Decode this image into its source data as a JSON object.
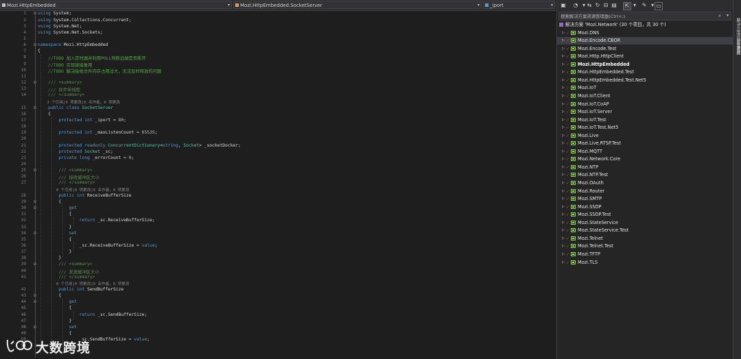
{
  "nav": {
    "project": "Mozi.HttpEmbedded",
    "class": "Mozi.HttpEmbedded.SocketServer",
    "member": "_iport"
  },
  "editor": {
    "lines": [
      {
        "n": 1,
        "seg": [
          [
            "kw",
            "using"
          ],
          [
            "id",
            " System;"
          ]
        ]
      },
      {
        "n": 2,
        "seg": [
          [
            "kw",
            "using"
          ],
          [
            "id",
            " System.Collections.Concurrent;"
          ]
        ]
      },
      {
        "n": 3,
        "seg": [
          [
            "kw",
            "using"
          ],
          [
            "id",
            " System.Net;"
          ]
        ]
      },
      {
        "n": 4,
        "seg": [
          [
            "kw",
            "using"
          ],
          [
            "id",
            " System.Net.Sockets;"
          ]
        ]
      },
      {
        "n": 5,
        "seg": []
      },
      {
        "n": 6,
        "seg": [
          [
            "kw",
            "namespace"
          ],
          [
            "id",
            " Mozi.HttpEmbedded"
          ]
        ]
      },
      {
        "n": 7,
        "seg": [
          [
            "id",
            "{"
          ]
        ]
      },
      {
        "n": 8,
        "seg": [
          [
            "cm",
            "    //TODO 加入定时器并利用POLL判断远端是否断开"
          ]
        ]
      },
      {
        "n": 9,
        "seg": [
          [
            "cm",
            "    //TODO 实现链接复用"
          ]
        ]
      },
      {
        "n": 10,
        "seg": [
          [
            "cm",
            "    //TODO 解决接收文件内存占用过大，无法及时释放的问题"
          ]
        ]
      },
      {
        "n": 11,
        "seg": []
      },
      {
        "n": 12,
        "seg": [
          [
            "xd",
            "    /// <summary>"
          ]
        ]
      },
      {
        "n": 13,
        "seg": [
          [
            "xd",
            "    /// 异步单线程"
          ]
        ]
      },
      {
        "n": 14,
        "seg": [
          [
            "xd",
            "    /// </summary>"
          ]
        ],
        "lens": "    3 个引用|0 项更改|0 名作者，0 项更改"
      },
      {
        "n": 15,
        "seg": [
          [
            "kw",
            "    public class "
          ],
          [
            "ty",
            "SocketServer"
          ]
        ]
      },
      {
        "n": 16,
        "seg": [
          [
            "id",
            "    {"
          ]
        ]
      },
      {
        "n": 17,
        "seg": [
          [
            "kw",
            "        protected int "
          ],
          [
            "id",
            "_iport = "
          ],
          [
            "num",
            "80"
          ],
          [
            "id",
            ";"
          ]
        ]
      },
      {
        "n": 18,
        "seg": []
      },
      {
        "n": 19,
        "seg": [
          [
            "kw",
            "        protected int "
          ],
          [
            "id",
            "_maxListenCount = "
          ],
          [
            "num",
            "65535"
          ],
          [
            "id",
            ";"
          ]
        ]
      },
      {
        "n": 20,
        "seg": []
      },
      {
        "n": 21,
        "seg": [
          [
            "kw",
            "        protected readonly "
          ],
          [
            "ty",
            "ConcurrentDictionary"
          ],
          [
            "id",
            "<"
          ],
          [
            "kw",
            "string"
          ],
          [
            "id",
            ", "
          ],
          [
            "ty",
            "Socket"
          ],
          [
            "id",
            "> _socketDocker;"
          ]
        ]
      },
      {
        "n": 22,
        "seg": [
          [
            "kw",
            "        protected "
          ],
          [
            "ty",
            "Socket"
          ],
          [
            "id",
            " _sc;"
          ]
        ]
      },
      {
        "n": 23,
        "seg": [
          [
            "kw",
            "        private long "
          ],
          [
            "id",
            "_errorCount = "
          ],
          [
            "num",
            "0"
          ],
          [
            "id",
            ";"
          ]
        ]
      },
      {
        "n": 24,
        "seg": []
      },
      {
        "n": 25,
        "seg": [
          [
            "xd",
            "        /// <summary>"
          ]
        ]
      },
      {
        "n": 26,
        "seg": [
          [
            "xd",
            "        /// 接收缓冲区大小"
          ]
        ]
      },
      {
        "n": 27,
        "seg": [
          [
            "xd",
            "        /// </summary>"
          ]
        ],
        "lens": "        0 个引用|0 项更改|0 名作者，0 项更改"
      },
      {
        "n": 28,
        "seg": [
          [
            "kw",
            "        public int "
          ],
          [
            "id",
            "ReceiveBufferSize"
          ]
        ]
      },
      {
        "n": 29,
        "seg": [
          [
            "id",
            "        {"
          ]
        ]
      },
      {
        "n": 30,
        "seg": [
          [
            "kw",
            "            get"
          ]
        ]
      },
      {
        "n": 31,
        "seg": [
          [
            "id",
            "            {"
          ]
        ]
      },
      {
        "n": 32,
        "seg": [
          [
            "kw",
            "                return "
          ],
          [
            "id",
            "_sc.ReceiveBufferSize;"
          ]
        ]
      },
      {
        "n": 33,
        "seg": [
          [
            "id",
            "            }"
          ]
        ]
      },
      {
        "n": 34,
        "seg": [
          [
            "kw",
            "            set"
          ]
        ]
      },
      {
        "n": 35,
        "seg": [
          [
            "id",
            "            {"
          ]
        ]
      },
      {
        "n": 36,
        "seg": [
          [
            "id",
            "                _sc.ReceiveBufferSize = "
          ],
          [
            "kw",
            "value"
          ],
          [
            "id",
            ";"
          ]
        ]
      },
      {
        "n": 37,
        "seg": [
          [
            "id",
            "            }"
          ]
        ]
      },
      {
        "n": 38,
        "seg": [
          [
            "id",
            "        }"
          ]
        ]
      },
      {
        "n": 39,
        "seg": [
          [
            "xd",
            "        /// <summary>"
          ]
        ]
      },
      {
        "n": 40,
        "seg": [
          [
            "xd",
            "        /// 发送缓冲区大小"
          ]
        ]
      },
      {
        "n": 41,
        "seg": [
          [
            "xd",
            "        /// </summary>"
          ]
        ],
        "lens": "        0 个引用|0 项更改|0 名作者，0 项更改"
      },
      {
        "n": 42,
        "seg": [
          [
            "kw",
            "        public int "
          ],
          [
            "id",
            "SendBufferSize"
          ]
        ]
      },
      {
        "n": 43,
        "seg": [
          [
            "id",
            "        {"
          ]
        ]
      },
      {
        "n": 44,
        "seg": [
          [
            "kw",
            "            get"
          ]
        ]
      },
      {
        "n": 45,
        "seg": [
          [
            "id",
            "            {"
          ]
        ]
      },
      {
        "n": 46,
        "seg": [
          [
            "kw",
            "                return "
          ],
          [
            "id",
            "_sc.SendBufferSize;"
          ]
        ]
      },
      {
        "n": 47,
        "seg": [
          [
            "id",
            "            }"
          ]
        ]
      },
      {
        "n": 48,
        "seg": [
          [
            "kw",
            "            set"
          ]
        ]
      },
      {
        "n": 49,
        "seg": [
          [
            "id",
            "            {"
          ]
        ]
      },
      {
        "n": 50,
        "seg": [
          [
            "id",
            "                _sc.SendBufferSize = "
          ],
          [
            "kw",
            "value"
          ],
          [
            "id",
            ";"
          ]
        ]
      },
      {
        "n": 51,
        "seg": [
          [
            "id",
            "            }"
          ]
        ]
      }
    ]
  },
  "watermark": {
    "text": "大数跨境"
  },
  "solution_explorer": {
    "search_placeholder": "搜索解决方案资源管理器(Ctrl+;)",
    "solution_label": "解决方案 'Mozi.Network' (30 个项目，共 30 个)",
    "projects": [
      "Mozi.DNS",
      "Mozi.Encode.CBOR",
      "Mozi.Encode.Test",
      "Mozi.Http.HttpClient",
      "Mozi.HttpEmbedded",
      "Mozi.HttpEmbedded.Test",
      "Mozi.HttpEmbedded.Test.Net5",
      "Mozi.IoT",
      "Mozi.IoT.Client",
      "Mozi.IoT.CoAP",
      "Mozi.IoT.Server",
      "Mozi.IoT.Test",
      "Mozi.IoT.Test.Net5",
      "Mozi.Live",
      "Mozi.Live.RTSP.Test",
      "Mozi.MQTT",
      "Mozi.Network.Core",
      "Mozi.NTP",
      "Mozi.NTP.Test",
      "Mozi.OAuth",
      "Mozi.Router",
      "Mozi.SMTP",
      "Mozi.SSDP",
      "Mozi.SSDP.Test",
      "Mozi.StateService",
      "Mozi.StateService.Test",
      "Mozi.Telnet",
      "Mozi.Telnet.Test",
      "Mozi.TFTP",
      "Mozi.TLS"
    ],
    "selected_project": "Mozi.Encode.CBOR",
    "bold_project": "Mozi.HttpEmbedded"
  },
  "side_tabs": [
    "解决方案资源管理器",
    "Git 更改"
  ]
}
